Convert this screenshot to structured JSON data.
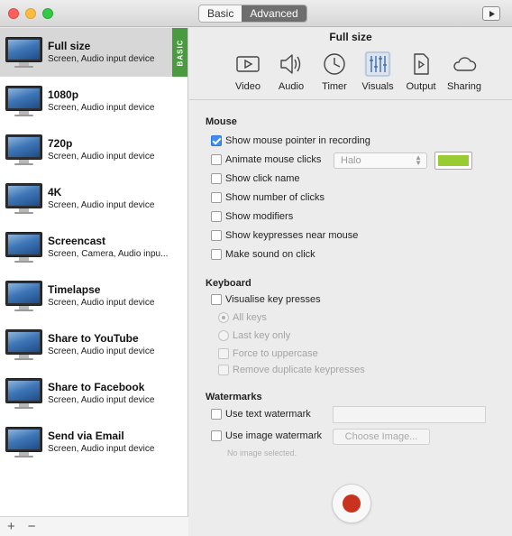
{
  "window": {
    "tabs": [
      {
        "label": "Basic",
        "active": false
      },
      {
        "label": "Advanced",
        "active": true
      }
    ]
  },
  "sidebar": {
    "badge": "BASIC",
    "presets": [
      {
        "title": "Full size",
        "subtitle": "Screen, Audio input device",
        "selected": true
      },
      {
        "title": "1080p",
        "subtitle": "Screen, Audio input device"
      },
      {
        "title": "720p",
        "subtitle": "Screen, Audio input device"
      },
      {
        "title": "4K",
        "subtitle": "Screen, Audio input device"
      },
      {
        "title": "Screencast",
        "subtitle": "Screen, Camera, Audio inpu..."
      },
      {
        "title": "Timelapse",
        "subtitle": "Screen, Audio input device"
      },
      {
        "title": "Share to YouTube",
        "subtitle": "Screen, Audio input device"
      },
      {
        "title": "Share to Facebook",
        "subtitle": "Screen, Audio input device"
      },
      {
        "title": "Send via Email",
        "subtitle": "Screen, Audio input device"
      }
    ],
    "footer": {
      "add": "+",
      "remove": "−"
    }
  },
  "pane": {
    "title": "Full size",
    "toolbar": [
      {
        "label": "Video",
        "icon": "video-icon"
      },
      {
        "label": "Audio",
        "icon": "speaker-icon"
      },
      {
        "label": "Timer",
        "icon": "clock-icon"
      },
      {
        "label": "Visuals",
        "icon": "sliders-icon",
        "active": true
      },
      {
        "label": "Output",
        "icon": "file-play-icon"
      },
      {
        "label": "Sharing",
        "icon": "cloud-icon"
      }
    ],
    "mouse": {
      "heading": "Mouse",
      "show_pointer": "Show mouse pointer in recording",
      "animate_clicks": "Animate mouse clicks",
      "halo_select": "Halo",
      "click_color": "#99cc33",
      "show_click_name": "Show click name",
      "show_number": "Show number of clicks",
      "show_modifiers": "Show modifiers",
      "show_keypresses": "Show keypresses near mouse",
      "make_sound": "Make sound on click"
    },
    "keyboard": {
      "heading": "Keyboard",
      "visualise": "Visualise key presses",
      "all_keys": "All keys",
      "last_key": "Last key only",
      "force_upper": "Force to uppercase",
      "remove_dup": "Remove duplicate keypresses"
    },
    "watermarks": {
      "heading": "Watermarks",
      "text_watermark": "Use text watermark",
      "image_watermark": "Use image watermark",
      "choose_image": "Choose Image...",
      "no_image": "No image selected."
    }
  }
}
